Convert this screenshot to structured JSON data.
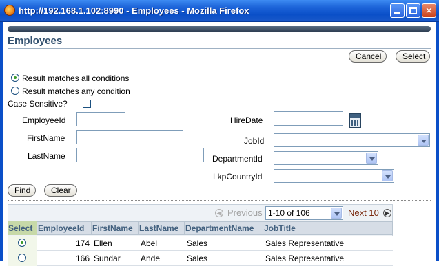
{
  "window": {
    "title": "http://192.168.1.102:8990 - Employees - Mozilla Firefox"
  },
  "page": {
    "title": "Employees",
    "cancel_label": "Cancel",
    "select_label": "Select"
  },
  "search": {
    "match_all_label": "Result matches all conditions",
    "match_any_label": "Result matches any condition",
    "match_mode": "all",
    "case_sensitive_label": "Case Sensitive?",
    "case_sensitive": false,
    "fields": {
      "employee_id": {
        "label": "EmployeeId",
        "value": ""
      },
      "first_name": {
        "label": "FirstName",
        "value": ""
      },
      "last_name": {
        "label": "LastName",
        "value": ""
      },
      "hire_date": {
        "label": "HireDate",
        "value": ""
      },
      "job_id": {
        "label": "JobId",
        "value": ""
      },
      "department_id": {
        "label": "DepartmentId",
        "value": ""
      },
      "lkp_country_id": {
        "label": "LkpCountryId",
        "value": ""
      }
    },
    "find_label": "Find",
    "clear_label": "Clear"
  },
  "results": {
    "previous_label": "Previous",
    "range_value": "1-10 of 106",
    "next_label": "Next 10",
    "columns": [
      "Select",
      "EmployeeId",
      "FirstName",
      "LastName",
      "DepartmentName",
      "JobTitle"
    ],
    "rows": [
      {
        "selected": true,
        "employee_id": "174",
        "first_name": "Ellen",
        "last_name": "Abel",
        "department": "Sales",
        "job_title": "Sales Representative"
      },
      {
        "selected": false,
        "employee_id": "166",
        "first_name": "Sundar",
        "last_name": "Ande",
        "department": "Sales",
        "job_title": "Sales Representative"
      }
    ]
  },
  "colors": {
    "titlebar": "#0a4fc8",
    "page_title": "#32506e",
    "header_text": "#42607e",
    "select_header_bg": "#c7d9a8",
    "next_link": "#7b2b10"
  }
}
